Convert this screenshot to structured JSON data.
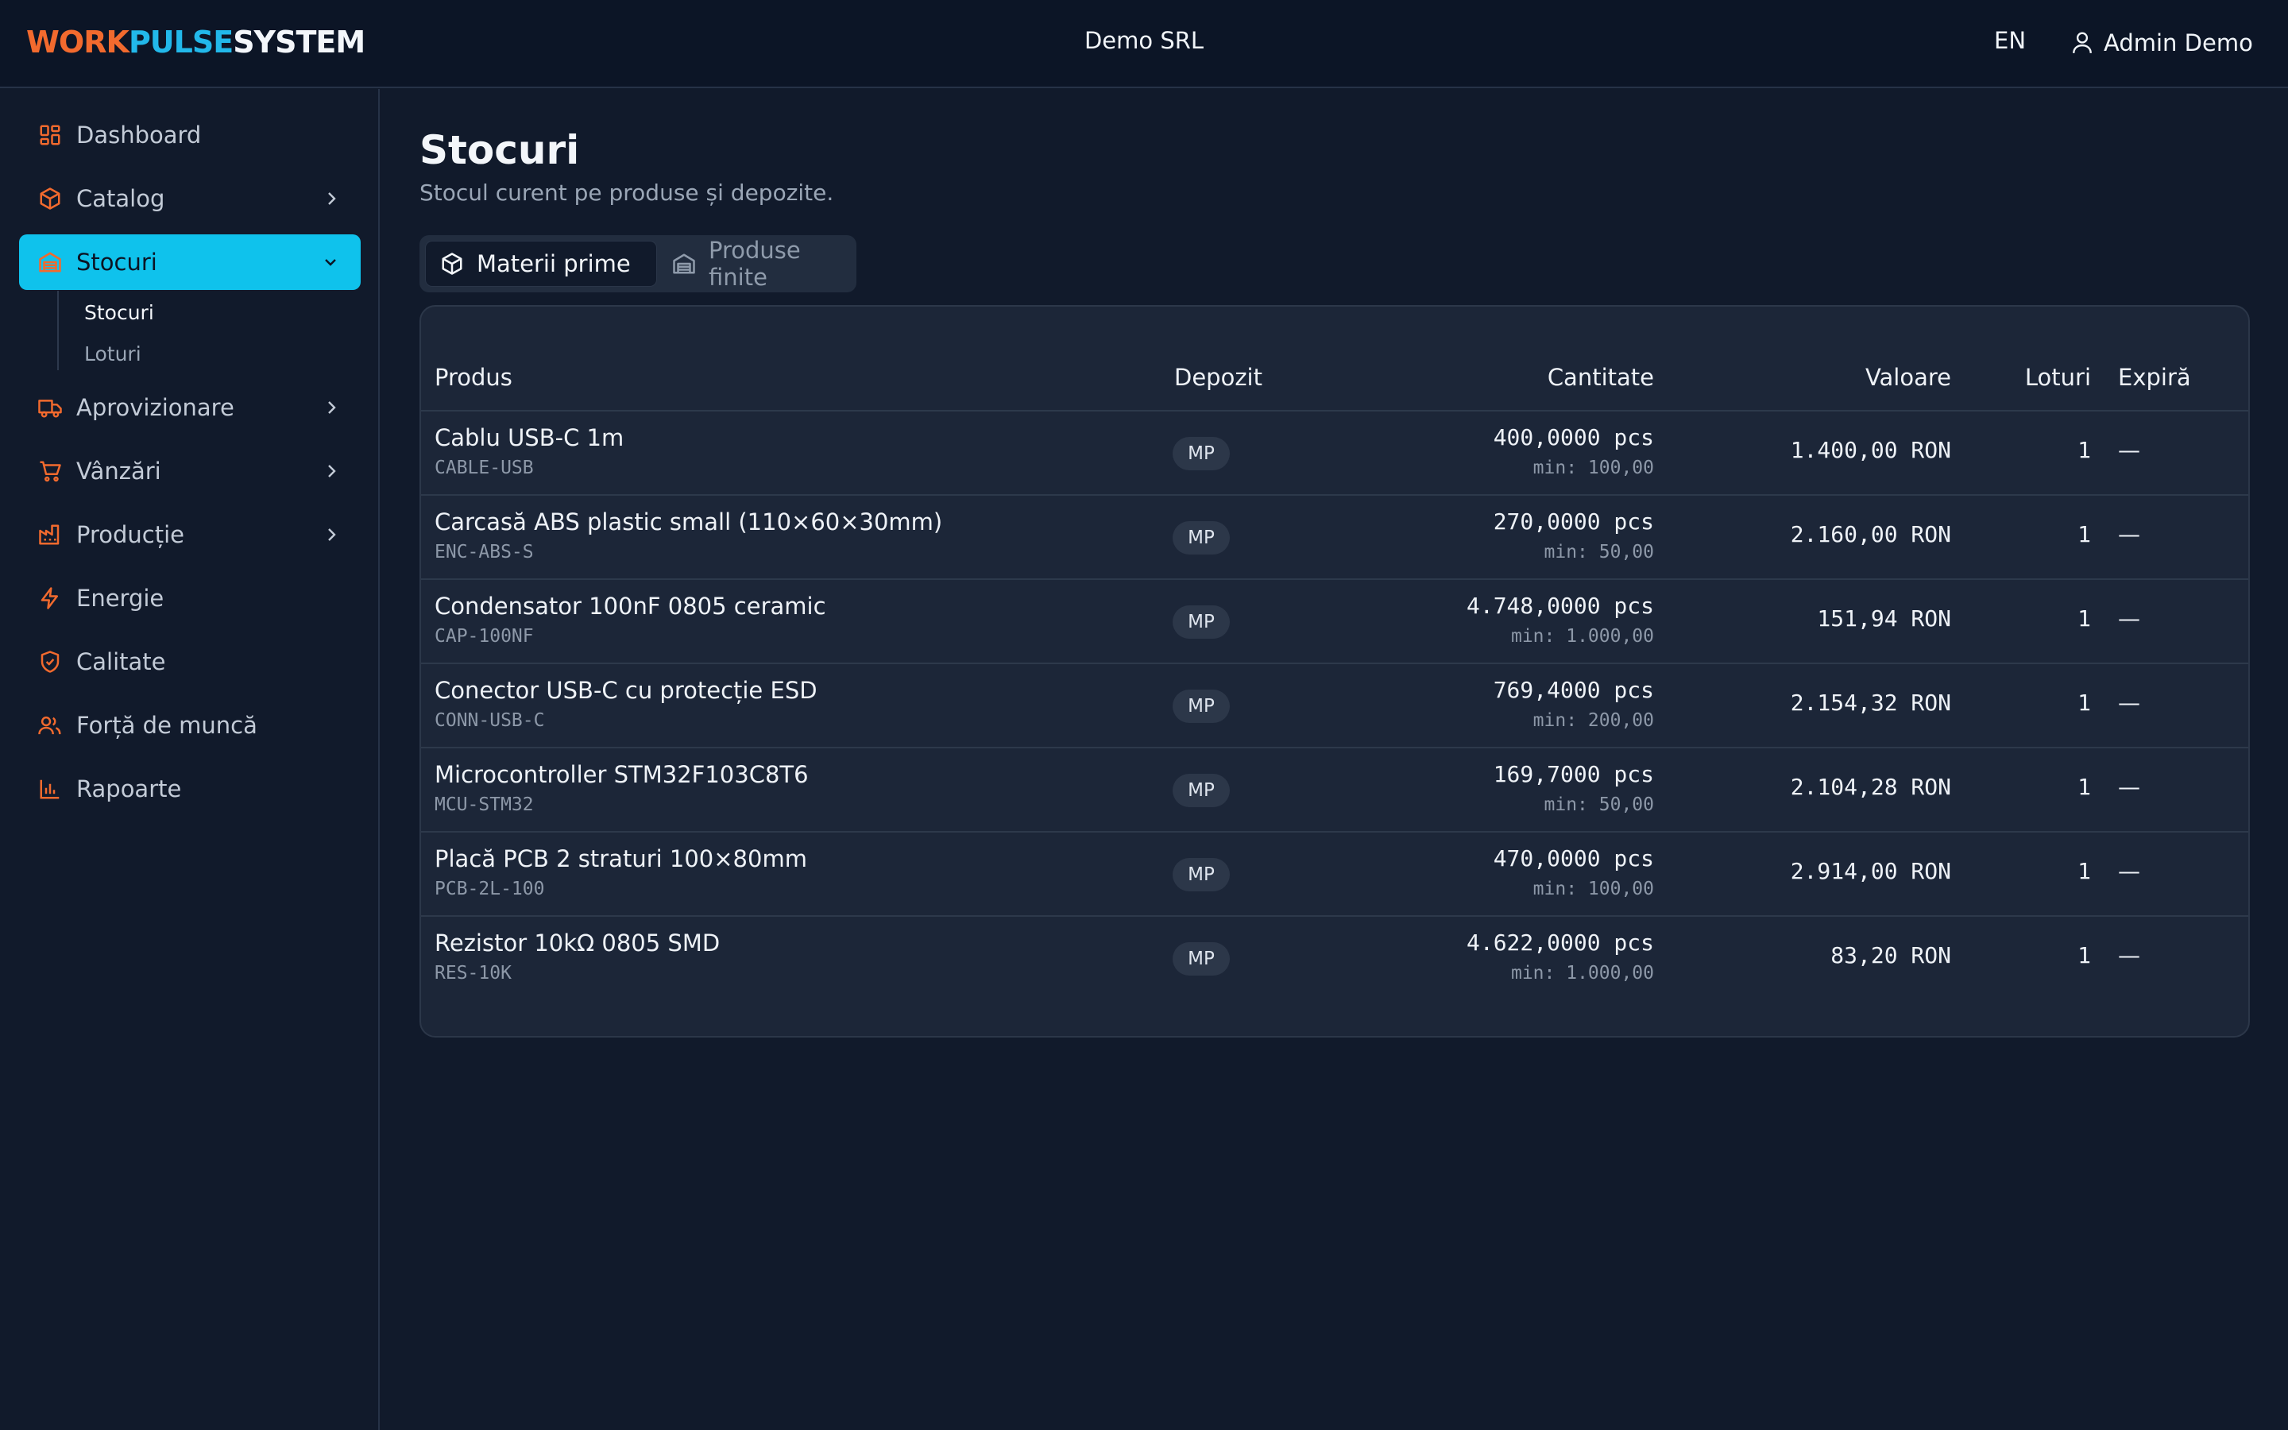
{
  "brand": {
    "part1": "WORK",
    "part2": "PULSE",
    "part3": "SYSTEM"
  },
  "header": {
    "company": "Demo SRL",
    "language": "EN",
    "user": "Admin Demo"
  },
  "colors": {
    "accent_orange": "#f26a2e",
    "accent_cyan": "#0fc2ec",
    "background": "#111a2b"
  },
  "sidebar": {
    "items": [
      {
        "label": "Dashboard",
        "icon": "dashboard-icon"
      },
      {
        "label": "Catalog",
        "icon": "box-icon"
      },
      {
        "label": "Stocuri",
        "icon": "warehouse-icon"
      },
      {
        "label": "Aprovizionare",
        "icon": "truck-icon"
      },
      {
        "label": "Vânzări",
        "icon": "cart-icon"
      },
      {
        "label": "Producție",
        "icon": "factory-icon"
      },
      {
        "label": "Energie",
        "icon": "bolt-icon"
      },
      {
        "label": "Calitate",
        "icon": "shield-check-icon"
      },
      {
        "label": "Forță de muncă",
        "icon": "users-icon"
      },
      {
        "label": "Rapoarte",
        "icon": "bar-chart-icon"
      }
    ],
    "subitems": [
      {
        "label": "Stocuri"
      },
      {
        "label": "Loturi"
      }
    ]
  },
  "main": {
    "title": "Stocuri",
    "subtitle": "Stocul curent pe produse și depozite.",
    "tabs": [
      {
        "label": "Materii prime",
        "icon": "box-icon"
      },
      {
        "label": "Produse finite",
        "icon": "warehouse-icon"
      }
    ]
  },
  "table": {
    "headers": {
      "product": "Produs",
      "warehouse": "Depozit",
      "quantity": "Cantitate",
      "value": "Valoare",
      "lots": "Loturi",
      "expires": "Expiră"
    },
    "rows": [
      {
        "name": "Cablu USB-C 1m",
        "sku": "CABLE-USB",
        "warehouse": "MP",
        "qty": "400,0000 pcs",
        "min": "min: 100,00",
        "value": "1.400,00 RON",
        "lots": "1",
        "expires": "—"
      },
      {
        "name": "Carcasă ABS plastic small (110×60×30mm)",
        "sku": "ENC-ABS-S",
        "warehouse": "MP",
        "qty": "270,0000 pcs",
        "min": "min: 50,00",
        "value": "2.160,00 RON",
        "lots": "1",
        "expires": "—"
      },
      {
        "name": "Condensator 100nF 0805 ceramic",
        "sku": "CAP-100NF",
        "warehouse": "MP",
        "qty": "4.748,0000 pcs",
        "min": "min: 1.000,00",
        "value": "151,94 RON",
        "lots": "1",
        "expires": "—"
      },
      {
        "name": "Conector USB-C cu protecție ESD",
        "sku": "CONN-USB-C",
        "warehouse": "MP",
        "qty": "769,4000 pcs",
        "min": "min: 200,00",
        "value": "2.154,32 RON",
        "lots": "1",
        "expires": "—"
      },
      {
        "name": "Microcontroller STM32F103C8T6",
        "sku": "MCU-STM32",
        "warehouse": "MP",
        "qty": "169,7000 pcs",
        "min": "min: 50,00",
        "value": "2.104,28 RON",
        "lots": "1",
        "expires": "—"
      },
      {
        "name": "Placă PCB 2 straturi 100×80mm",
        "sku": "PCB-2L-100",
        "warehouse": "MP",
        "qty": "470,0000 pcs",
        "min": "min: 100,00",
        "value": "2.914,00 RON",
        "lots": "1",
        "expires": "—"
      },
      {
        "name": "Rezistor 10kΩ 0805 SMD",
        "sku": "RES-10K",
        "warehouse": "MP",
        "qty": "4.622,0000 pcs",
        "min": "min: 1.000,00",
        "value": "83,20 RON",
        "lots": "1",
        "expires": "—"
      }
    ]
  }
}
